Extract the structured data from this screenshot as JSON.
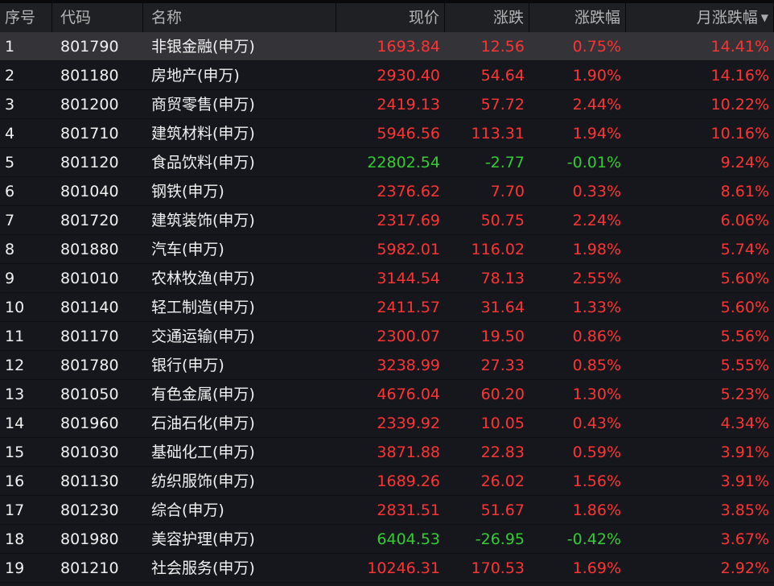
{
  "headers": {
    "seq": "序号",
    "code": "代码",
    "name": "名称",
    "price": "现价",
    "change": "涨跌",
    "pct": "涨跌幅",
    "month": "月涨跌幅"
  },
  "colors": {
    "up": "#ff3333",
    "down": "#33cc33"
  },
  "rows": [
    [
      "1",
      "801790",
      "非银金融(申万)",
      "1693.84",
      "12.56",
      "0.75%",
      "14.41%"
    ],
    [
      "2",
      "801180",
      "房地产(申万)",
      "2930.40",
      "54.64",
      "1.90%",
      "14.16%"
    ],
    [
      "3",
      "801200",
      "商贸零售(申万)",
      "2419.13",
      "57.72",
      "2.44%",
      "10.22%"
    ],
    [
      "4",
      "801710",
      "建筑材料(申万)",
      "5946.56",
      "113.31",
      "1.94%",
      "10.16%"
    ],
    [
      "5",
      "801120",
      "食品饮料(申万)",
      "22802.54",
      "-2.77",
      "-0.01%",
      "9.24%"
    ],
    [
      "6",
      "801040",
      "钢铁(申万)",
      "2376.62",
      "7.70",
      "0.33%",
      "8.61%"
    ],
    [
      "7",
      "801720",
      "建筑装饰(申万)",
      "2317.69",
      "50.75",
      "2.24%",
      "6.06%"
    ],
    [
      "8",
      "801880",
      "汽车(申万)",
      "5982.01",
      "116.02",
      "1.98%",
      "5.74%"
    ],
    [
      "9",
      "801010",
      "农林牧渔(申万)",
      "3144.54",
      "78.13",
      "2.55%",
      "5.60%"
    ],
    [
      "10",
      "801140",
      "轻工制造(申万)",
      "2411.57",
      "31.64",
      "1.33%",
      "5.60%"
    ],
    [
      "11",
      "801170",
      "交通运输(申万)",
      "2300.07",
      "19.50",
      "0.86%",
      "5.56%"
    ],
    [
      "12",
      "801780",
      "银行(申万)",
      "3238.99",
      "27.33",
      "0.85%",
      "5.55%"
    ],
    [
      "13",
      "801050",
      "有色金属(申万)",
      "4676.04",
      "60.20",
      "1.30%",
      "5.23%"
    ],
    [
      "14",
      "801960",
      "石油石化(申万)",
      "2339.92",
      "10.05",
      "0.43%",
      "4.34%"
    ],
    [
      "15",
      "801030",
      "基础化工(申万)",
      "3871.88",
      "22.83",
      "0.59%",
      "3.91%"
    ],
    [
      "16",
      "801130",
      "纺织服饰(申万)",
      "1689.26",
      "26.02",
      "1.56%",
      "3.91%"
    ],
    [
      "17",
      "801230",
      "综合(申万)",
      "2831.51",
      "51.67",
      "1.86%",
      "3.85%"
    ],
    [
      "18",
      "801980",
      "美容护理(申万)",
      "6404.53",
      "-26.95",
      "-0.42%",
      "3.67%"
    ],
    [
      "19",
      "801210",
      "社会服务(申万)",
      "10246.31",
      "170.53",
      "1.69%",
      "2.92%"
    ]
  ]
}
